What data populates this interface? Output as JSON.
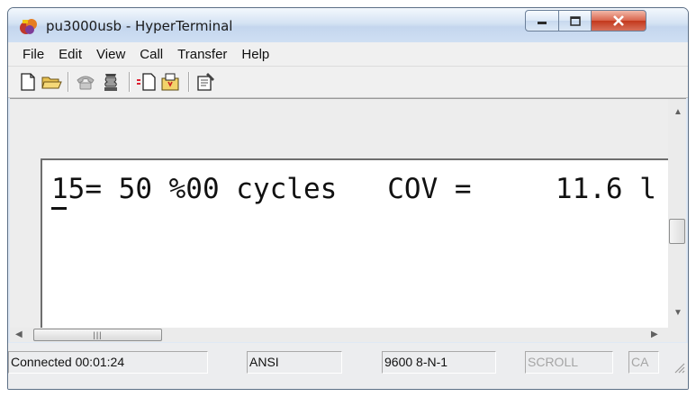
{
  "window": {
    "title": "pu3000usb - HyperTerminal",
    "icon": "hyperterminal-app-icon"
  },
  "menu": [
    "File",
    "Edit",
    "View",
    "Call",
    "Transfer",
    "Help"
  ],
  "toolbar": {
    "buttons": [
      "new-document-icon",
      "open-folder-icon",
      "disconnect-phone-icon",
      "dial-phone-icon",
      "send-file-icon",
      "receive-file-icon",
      "properties-icon"
    ]
  },
  "terminal": {
    "line": "15= 50 %00 cycles   COV =     11.6 l"
  },
  "status": {
    "connected": "Connected 00:01:24",
    "emulation": "ANSI",
    "port_settings": "9600 8-N-1",
    "scroll": "SCROLL",
    "caps": "CA"
  },
  "colors": {
    "close_button": "#c3381c",
    "titlebar": "#d4e2f3"
  }
}
